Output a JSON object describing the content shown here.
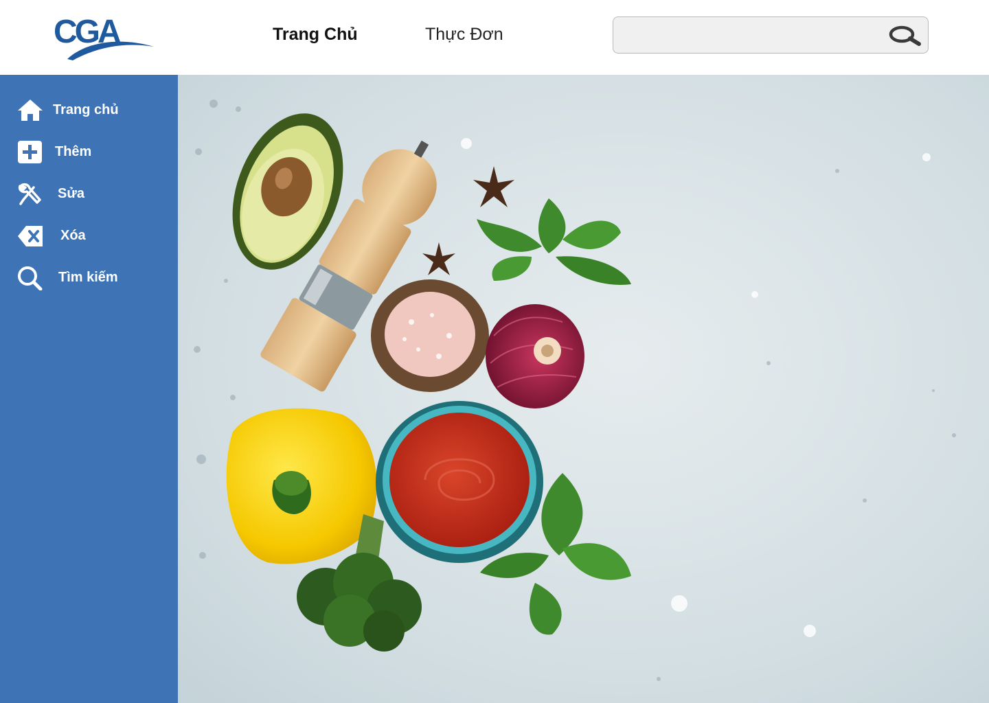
{
  "header": {
    "logo_text": "CGA",
    "nav": [
      {
        "label": "Trang Chủ"
      },
      {
        "label": "Thực Đơn"
      }
    ],
    "search": {
      "value": "",
      "placeholder": ""
    }
  },
  "sidebar": {
    "items": [
      {
        "label": "Trang chủ",
        "icon": "home-icon"
      },
      {
        "label": "Thêm",
        "icon": "plus-square-icon"
      },
      {
        "label": "Sửa",
        "icon": "wrench-icon"
      },
      {
        "label": "Xóa",
        "icon": "backspace-x-icon"
      },
      {
        "label": "Tìm kiếm",
        "icon": "search-icon"
      }
    ]
  },
  "colors": {
    "sidebar_bg": "#3e73b5",
    "logo_blue": "#1f5a9e",
    "search_bg": "#f0f0f0"
  }
}
